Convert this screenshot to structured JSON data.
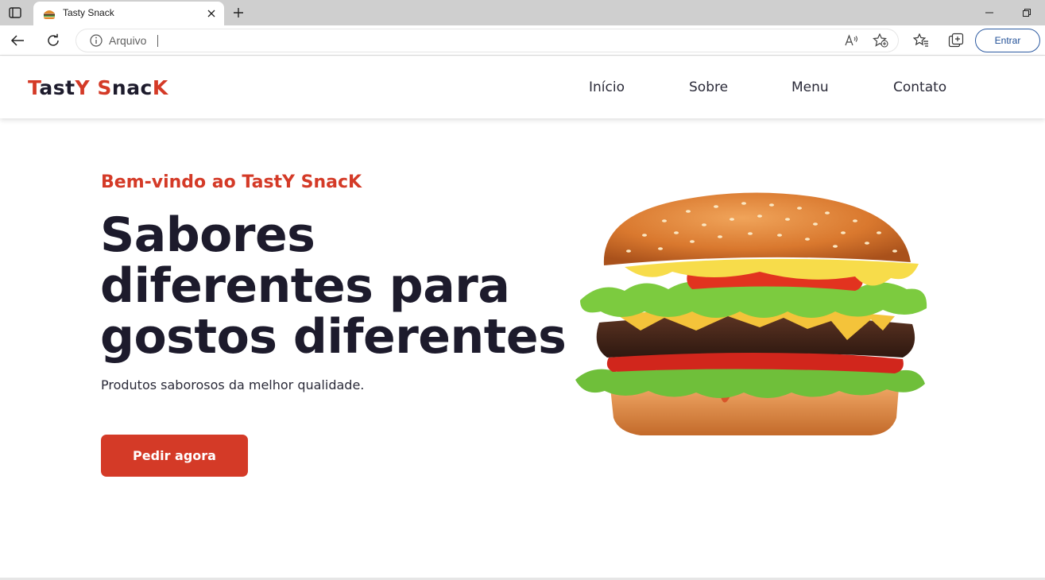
{
  "browser": {
    "tab": {
      "title": "Tasty Snack",
      "favicon": "burger-favicon-icon"
    },
    "address": {
      "label": "Arquivo",
      "value": ""
    },
    "signin_label": "Entrar",
    "colors": {
      "tabbar": "#cfcfcf",
      "signin": "#2c5aa0"
    }
  },
  "site": {
    "logo": {
      "part1": "T",
      "part2": "ast",
      "part3": "Y",
      "part4": " ",
      "part5": "S",
      "part6": "nac",
      "part7": "K"
    },
    "nav": [
      {
        "label": "Início"
      },
      {
        "label": "Sobre"
      },
      {
        "label": "Menu"
      },
      {
        "label": "Contato"
      }
    ],
    "hero": {
      "subtitle": "Bem-vindo ao TastY SnacK",
      "title_line1": "Sabores",
      "title_line2": "diferentes para",
      "title_line3": "gostos diferentes",
      "description": "Produtos saborosos da melhor qualidade.",
      "cta_label": "Pedir agora",
      "image": "burger-image"
    },
    "colors": {
      "accent": "#d43a27",
      "text": "#1d1b2c"
    }
  }
}
